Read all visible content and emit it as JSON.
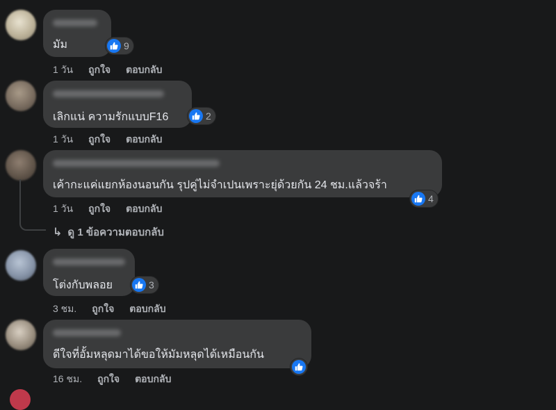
{
  "comments": [
    {
      "text": "มัม",
      "reactions": "9",
      "time": "1 วัน",
      "like": "ถูกใจ",
      "reply": "ตอบกลับ"
    },
    {
      "text": "เลิกแน่ ความรักแบบF16",
      "reactions": "2",
      "time": "1 วัน",
      "like": "ถูกใจ",
      "reply": "ตอบกลับ"
    },
    {
      "text": "เค้ากะแค่แยกห้องนอนกัน รุปคู่ไม่จำเปนเพราะยุ่ด้วยกัน 24 ชม.แล้วจร้า",
      "reactions": "4",
      "time": "1 วัน",
      "like": "ถูกใจ",
      "reply": "ตอบกลับ"
    },
    {
      "text": "โต่งกับพลอย",
      "reactions": "3",
      "time": "3 ชม.",
      "like": "ถูกใจ",
      "reply": "ตอบกลับ"
    },
    {
      "text": "ดีใจที่อั้มหลุดมาได้ขอให้มัมหลุดได้เหมือนกัน",
      "reactions": "",
      "time": "16 ชม.",
      "like": "ถูกใจ",
      "reply": "ตอบกลับ"
    }
  ],
  "view_replies": "ดู 1 ข้อความตอบกลับ",
  "colors": {
    "background": "#18191a",
    "bubble": "#3a3b3c",
    "like_blue": "#1877f2",
    "meta_text": "#b0b3b8"
  },
  "icons": {
    "like": "thumbs-up-icon",
    "reply_arrow": "reply-arrow-icon"
  }
}
